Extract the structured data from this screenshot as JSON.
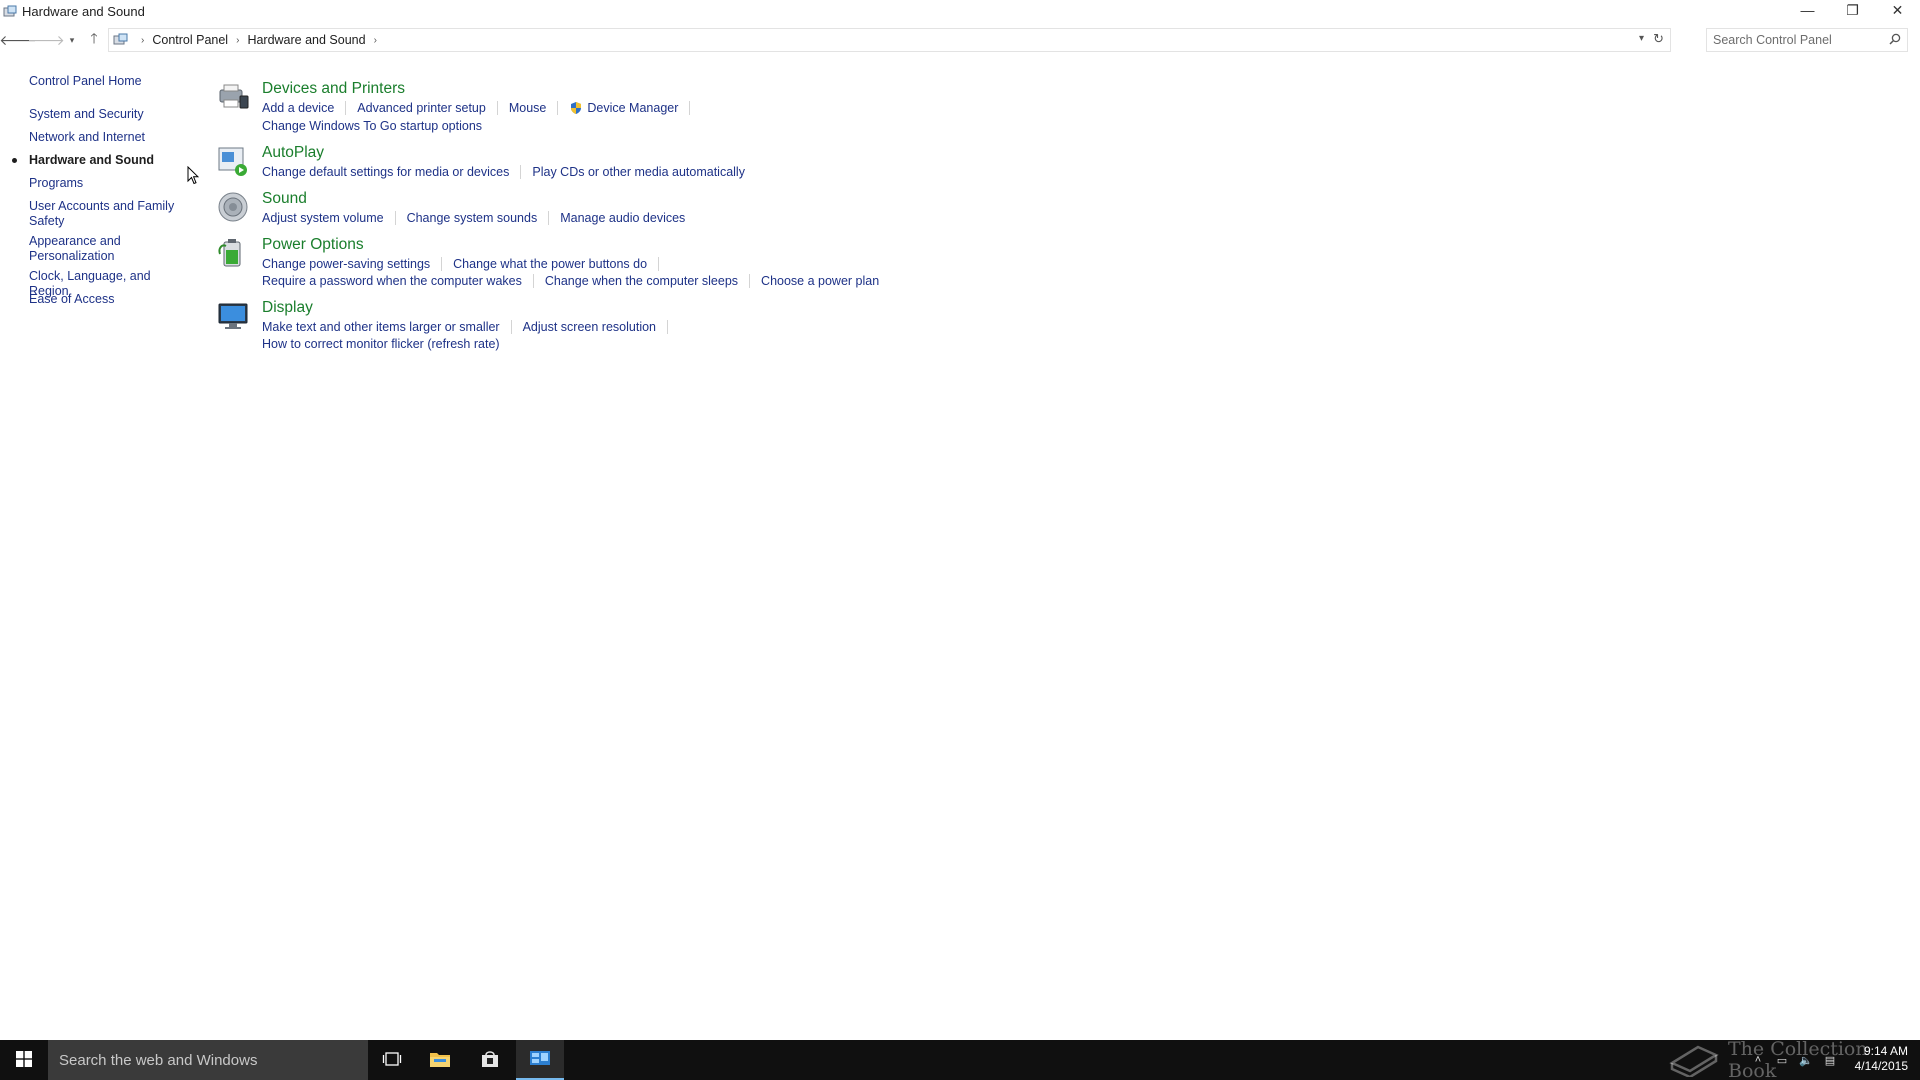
{
  "window": {
    "title": "Hardware and Sound",
    "controls": {
      "minimize": "—",
      "restore": "❐",
      "close": "✕"
    }
  },
  "addressbar": {
    "breadcrumbs": [
      "Control Panel",
      "Hardware and Sound"
    ],
    "search_placeholder": "Search Control Panel"
  },
  "leftnav": {
    "home": "Control Panel Home",
    "items": [
      {
        "label": "System and Security"
      },
      {
        "label": "Network and Internet"
      },
      {
        "label": "Hardware and Sound",
        "current": true
      },
      {
        "label": "Programs"
      },
      {
        "label": "User Accounts and Family Safety"
      },
      {
        "label": "Appearance and Personalization"
      },
      {
        "label": "Clock, Language, and Region"
      },
      {
        "label": "Ease of Access"
      }
    ]
  },
  "categories": [
    {
      "title": "Devices and Printers",
      "icon": "devices-printers-icon",
      "tasks": [
        [
          "Add a device",
          "Advanced printer setup",
          "Mouse",
          "Device Manager"
        ],
        [
          "Change Windows To Go startup options"
        ]
      ]
    },
    {
      "title": "AutoPlay",
      "icon": "autoplay-icon",
      "tasks": [
        [
          "Change default settings for media or devices",
          "Play CDs or other media automatically"
        ]
      ]
    },
    {
      "title": "Sound",
      "icon": "speaker-icon",
      "tasks": [
        [
          "Adjust system volume",
          "Change system sounds",
          "Manage audio devices"
        ]
      ]
    },
    {
      "title": "Power Options",
      "icon": "battery-icon",
      "tasks": [
        [
          "Change power-saving settings",
          "Change what the power buttons do"
        ],
        [
          "Require a password when the computer wakes",
          "Change when the computer sleeps",
          "Choose a power plan"
        ]
      ]
    },
    {
      "title": "Display",
      "icon": "monitor-icon",
      "tasks": [
        [
          "Make text and other items larger or smaller",
          "Adjust screen resolution"
        ],
        [
          "How to correct monitor flicker (refresh rate)"
        ]
      ]
    }
  ],
  "taskbar": {
    "search_placeholder": "Search the web and Windows",
    "watermark": "The Collection Book",
    "time": "9:14 AM",
    "date": "4/14/2015"
  },
  "colors": {
    "link": "#1e3287",
    "category_title": "#1a7e2c",
    "taskbar": "#101010"
  }
}
